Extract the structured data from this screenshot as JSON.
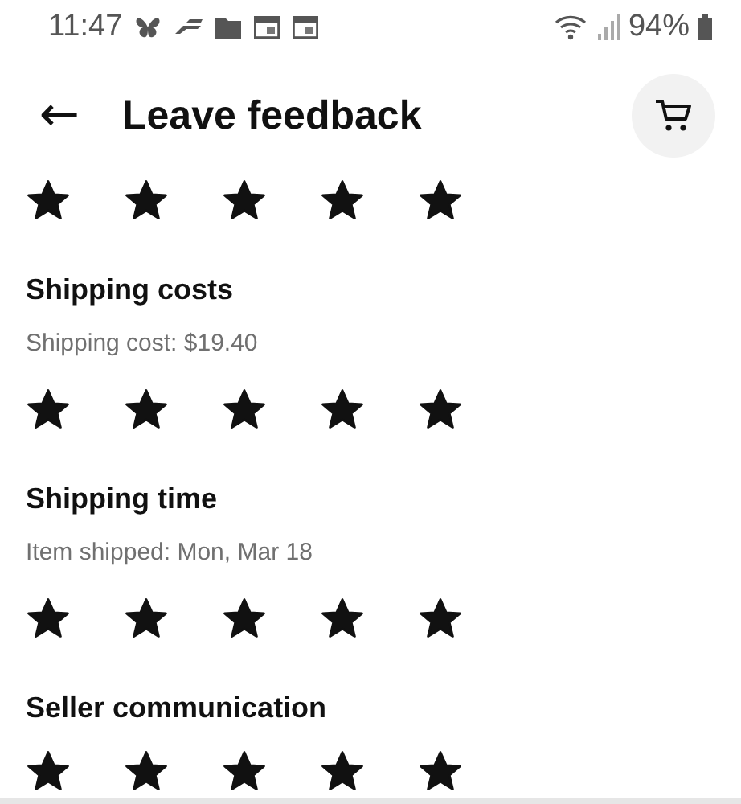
{
  "status_bar": {
    "time": "11:47",
    "battery": "94%"
  },
  "header": {
    "back": "←",
    "title": "Leave feedback"
  },
  "sections": [
    {
      "stars": 5
    },
    {
      "title": "Shipping costs",
      "subtitle": "Shipping cost: $19.40",
      "stars": 5
    },
    {
      "title": "Shipping time",
      "subtitle": "Item shipped: Mon, Mar 18",
      "stars": 5
    },
    {
      "title": "Seller communication",
      "stars": 5
    }
  ]
}
